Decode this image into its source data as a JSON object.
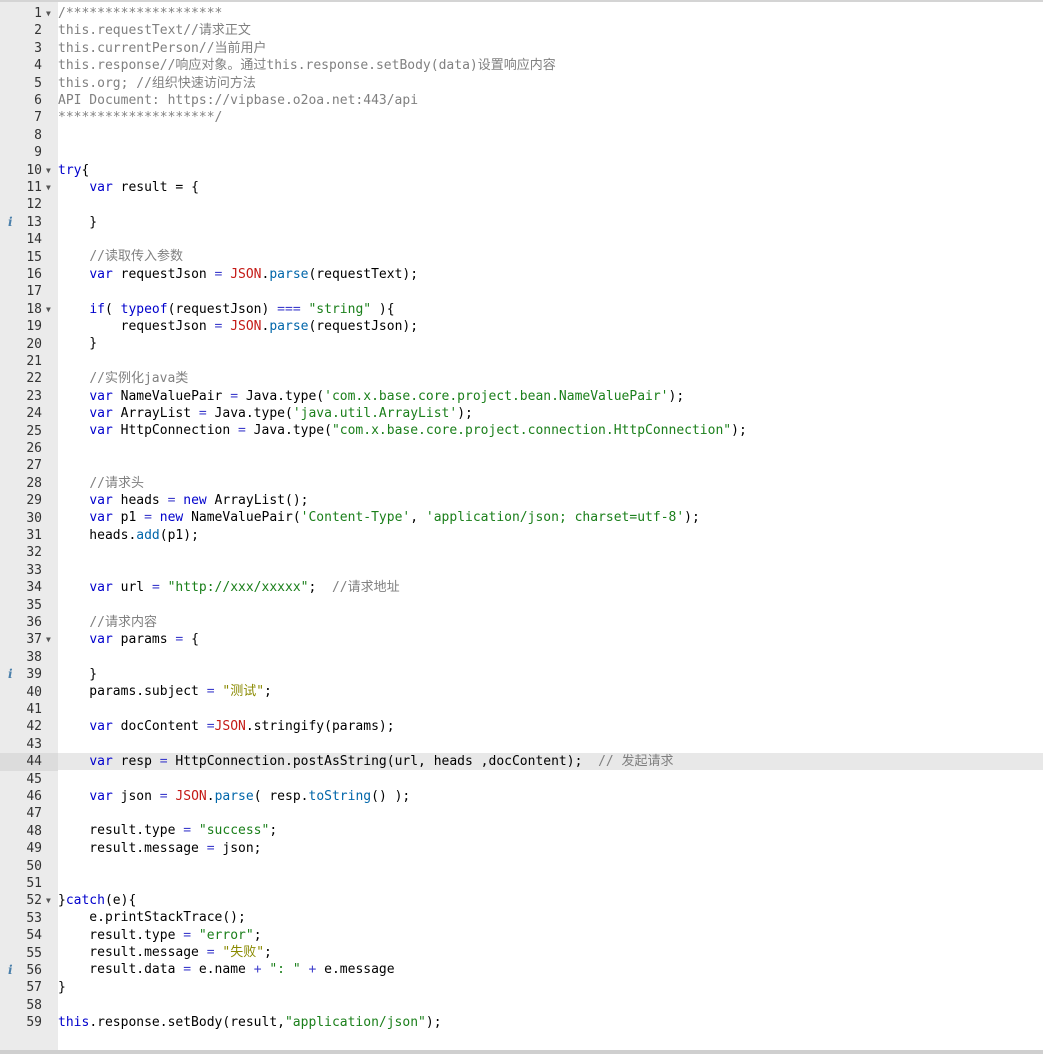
{
  "editor": {
    "active_line": 44,
    "folded_markers": [
      1,
      10,
      11,
      18,
      37,
      52
    ],
    "info_markers": [
      13,
      39,
      56
    ],
    "lines": [
      [
        [
          "comment",
          "/********************"
        ]
      ],
      [
        [
          "comment",
          "this.requestText//请求正文"
        ]
      ],
      [
        [
          "comment",
          "this.currentPerson//当前用户"
        ]
      ],
      [
        [
          "comment",
          "this.response//响应对象。通过this.response.setBody(data)设置响应内容"
        ]
      ],
      [
        [
          "comment",
          "this.org; //组织快速访问方法"
        ]
      ],
      [
        [
          "comment",
          "API Document: https://vipbase.o2oa.net:443/api"
        ]
      ],
      [
        [
          "comment",
          "********************/"
        ]
      ],
      [],
      [],
      [
        [
          "keyword",
          "try"
        ],
        [
          "plain",
          "{"
        ]
      ],
      [
        [
          "plain",
          "    "
        ],
        [
          "keyword",
          "var"
        ],
        [
          "plain",
          " result = {"
        ]
      ],
      [
        [
          "plain",
          "    "
        ]
      ],
      [
        [
          "plain",
          "    }"
        ]
      ],
      [],
      [
        [
          "plain",
          "    "
        ],
        [
          "comment",
          "//读取传入参数"
        ]
      ],
      [
        [
          "plain",
          "    "
        ],
        [
          "keyword",
          "var"
        ],
        [
          "plain",
          " requestJson "
        ],
        [
          "op",
          "="
        ],
        [
          "plain",
          " "
        ],
        [
          "builtin",
          "JSON"
        ],
        [
          "plain",
          "."
        ],
        [
          "prop",
          "parse"
        ],
        [
          "plain",
          "(requestText);"
        ]
      ],
      [],
      [
        [
          "plain",
          "    "
        ],
        [
          "keyword",
          "if"
        ],
        [
          "plain",
          "( "
        ],
        [
          "keyword",
          "typeof"
        ],
        [
          "plain",
          "(requestJson) "
        ],
        [
          "op",
          "==="
        ],
        [
          "plain",
          " "
        ],
        [
          "string",
          "\"string\""
        ],
        [
          "plain",
          " ){"
        ]
      ],
      [
        [
          "plain",
          "        requestJson "
        ],
        [
          "op",
          "="
        ],
        [
          "plain",
          " "
        ],
        [
          "builtin",
          "JSON"
        ],
        [
          "plain",
          "."
        ],
        [
          "prop",
          "parse"
        ],
        [
          "plain",
          "(requestJson);"
        ]
      ],
      [
        [
          "plain",
          "    }"
        ]
      ],
      [],
      [
        [
          "plain",
          "    "
        ],
        [
          "comment",
          "//实例化java类"
        ]
      ],
      [
        [
          "plain",
          "    "
        ],
        [
          "keyword",
          "var"
        ],
        [
          "plain",
          " NameValuePair "
        ],
        [
          "op",
          "="
        ],
        [
          "plain",
          " Java.type("
        ],
        [
          "string",
          "'com.x.base.core.project.bean.NameValuePair'"
        ],
        [
          "plain",
          ");"
        ]
      ],
      [
        [
          "plain",
          "    "
        ],
        [
          "keyword",
          "var"
        ],
        [
          "plain",
          " ArrayList "
        ],
        [
          "op",
          "="
        ],
        [
          "plain",
          " Java.type("
        ],
        [
          "string",
          "'java.util.ArrayList'"
        ],
        [
          "plain",
          ");"
        ]
      ],
      [
        [
          "plain",
          "    "
        ],
        [
          "keyword",
          "var"
        ],
        [
          "plain",
          " HttpConnection "
        ],
        [
          "op",
          "="
        ],
        [
          "plain",
          " Java.type("
        ],
        [
          "string",
          "\"com.x.base.core.project.connection.HttpConnection\""
        ],
        [
          "plain",
          ");"
        ]
      ],
      [],
      [],
      [
        [
          "plain",
          "    "
        ],
        [
          "comment",
          "//请求头"
        ]
      ],
      [
        [
          "plain",
          "    "
        ],
        [
          "keyword",
          "var"
        ],
        [
          "plain",
          " heads "
        ],
        [
          "op",
          "="
        ],
        [
          "plain",
          " "
        ],
        [
          "keyword",
          "new"
        ],
        [
          "plain",
          " ArrayList();"
        ]
      ],
      [
        [
          "plain",
          "    "
        ],
        [
          "keyword",
          "var"
        ],
        [
          "plain",
          " p1 "
        ],
        [
          "op",
          "="
        ],
        [
          "plain",
          " "
        ],
        [
          "keyword",
          "new"
        ],
        [
          "plain",
          " NameValuePair("
        ],
        [
          "string",
          "'Content-Type'"
        ],
        [
          "plain",
          ", "
        ],
        [
          "string",
          "'application/json; charset=utf-8'"
        ],
        [
          "plain",
          ");"
        ]
      ],
      [
        [
          "plain",
          "    heads."
        ],
        [
          "prop",
          "add"
        ],
        [
          "plain",
          "(p1);"
        ]
      ],
      [],
      [],
      [
        [
          "plain",
          "    "
        ],
        [
          "keyword",
          "var"
        ],
        [
          "plain",
          " url "
        ],
        [
          "op",
          "="
        ],
        [
          "plain",
          " "
        ],
        [
          "string",
          "\"http://xxx/xxxxx\""
        ],
        [
          "plain",
          ";  "
        ],
        [
          "comment",
          "//请求地址"
        ]
      ],
      [],
      [
        [
          "plain",
          "    "
        ],
        [
          "comment",
          "//请求内容"
        ]
      ],
      [
        [
          "plain",
          "    "
        ],
        [
          "keyword",
          "var"
        ],
        [
          "plain",
          " params "
        ],
        [
          "op",
          "="
        ],
        [
          "plain",
          " {"
        ]
      ],
      [],
      [
        [
          "plain",
          "    }"
        ]
      ],
      [
        [
          "plain",
          "    params.subject "
        ],
        [
          "op",
          "="
        ],
        [
          "plain",
          " "
        ],
        [
          "string-cn",
          "\"测试\""
        ],
        [
          "plain",
          ";"
        ]
      ],
      [],
      [
        [
          "plain",
          "    "
        ],
        [
          "keyword",
          "var"
        ],
        [
          "plain",
          " docContent "
        ],
        [
          "op",
          "="
        ],
        [
          "builtin",
          "JSON"
        ],
        [
          "plain",
          ".stringify(params);"
        ]
      ],
      [],
      [
        [
          "plain",
          "    "
        ],
        [
          "keyword",
          "var"
        ],
        [
          "plain",
          " resp "
        ],
        [
          "op",
          "="
        ],
        [
          "plain",
          " HttpConnection.postAsString(url, heads ,docContent);  "
        ],
        [
          "comment",
          "// 发起请求"
        ]
      ],
      [],
      [
        [
          "plain",
          "    "
        ],
        [
          "keyword",
          "var"
        ],
        [
          "plain",
          " json "
        ],
        [
          "op",
          "="
        ],
        [
          "plain",
          " "
        ],
        [
          "builtin",
          "JSON"
        ],
        [
          "plain",
          "."
        ],
        [
          "prop",
          "parse"
        ],
        [
          "plain",
          "( resp."
        ],
        [
          "prop",
          "toString"
        ],
        [
          "plain",
          "() );"
        ]
      ],
      [],
      [
        [
          "plain",
          "    result.type "
        ],
        [
          "op",
          "="
        ],
        [
          "plain",
          " "
        ],
        [
          "string",
          "\"success\""
        ],
        [
          "plain",
          ";"
        ]
      ],
      [
        [
          "plain",
          "    result.message "
        ],
        [
          "op",
          "="
        ],
        [
          "plain",
          " json;"
        ]
      ],
      [],
      [],
      [
        [
          "plain",
          "}"
        ],
        [
          "keyword",
          "catch"
        ],
        [
          "plain",
          "(e){"
        ]
      ],
      [
        [
          "plain",
          "    e.printStackTrace();"
        ]
      ],
      [
        [
          "plain",
          "    result.type "
        ],
        [
          "op",
          "="
        ],
        [
          "plain",
          " "
        ],
        [
          "string",
          "\"error\""
        ],
        [
          "plain",
          ";"
        ]
      ],
      [
        [
          "plain",
          "    result.message "
        ],
        [
          "op",
          "="
        ],
        [
          "plain",
          " "
        ],
        [
          "string-cn",
          "\"失败\""
        ],
        [
          "plain",
          ";"
        ]
      ],
      [
        [
          "plain",
          "    result.data "
        ],
        [
          "op",
          "="
        ],
        [
          "plain",
          " e.name "
        ],
        [
          "op",
          "+"
        ],
        [
          "plain",
          " "
        ],
        [
          "string",
          "\": \""
        ],
        [
          "plain",
          " "
        ],
        [
          "op",
          "+"
        ],
        [
          "plain",
          " e.message"
        ]
      ],
      [
        [
          "plain",
          "}"
        ]
      ],
      [],
      [
        [
          "keyword",
          "this"
        ],
        [
          "plain",
          ".response.setBody(result,"
        ],
        [
          "string",
          "\"application/json\""
        ],
        [
          "plain",
          ");"
        ]
      ]
    ]
  }
}
